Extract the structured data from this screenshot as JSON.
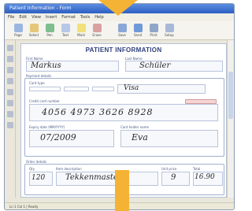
{
  "window": {
    "title": "Patient Information - Form"
  },
  "menu": [
    "File",
    "Edit",
    "View",
    "Insert",
    "Format",
    "Tools",
    "Help"
  ],
  "toolbar": [
    {
      "icon": "page-icon",
      "label": "Page",
      "color": "#9cb6e2"
    },
    {
      "icon": "select-icon",
      "label": "Select",
      "color": "#e6c77a"
    },
    {
      "icon": "pen-icon",
      "label": "Pen",
      "color": "#7fbf8f"
    },
    {
      "icon": "text-icon",
      "label": "Text",
      "color": "#b6c7e8"
    },
    {
      "icon": "highlight-icon",
      "label": "Mark",
      "color": "#f2e07a"
    },
    {
      "icon": "erase-icon",
      "label": "Erase",
      "color": "#d9a1a1"
    },
    {
      "icon": "save-icon",
      "label": "Save",
      "color": "#8aa7d6"
    },
    {
      "icon": "send-icon",
      "label": "Send",
      "color": "#6f9ad8"
    },
    {
      "icon": "print-icon",
      "label": "Print",
      "color": "#8fa6c9"
    },
    {
      "icon": "settings-icon",
      "label": "Setup",
      "color": "#a7b8d8"
    }
  ],
  "form": {
    "title": "PATIENT INFORMATION",
    "first_name_label": "First Name",
    "first_name_value": "Markus",
    "last_name_label": "Last Name",
    "last_name_value": "Schüler",
    "payment_label": "Payment details",
    "card_type_label": "Card type",
    "card_type_value": "Visa",
    "card_number_label": "Credit card number",
    "card_number_value": "4056 4973 3626 8928",
    "expiry_label": "Expiry date (MM/YYYY)",
    "expiry_value": "07/2009",
    "cardholder_label": "Card holder name",
    "cardholder_value": "Eva",
    "order_label": "Order details",
    "qty_label": "Qty",
    "qty_value": "120",
    "item_label": "Item description",
    "item_value": "Tekkenmaster",
    "unit_label": "Unit price",
    "unit_value": "9",
    "total_label": "Total",
    "total_value": "16.90"
  },
  "status": {
    "text": "Ln 1 Col 1 | Ready"
  },
  "accent": {
    "highlight": "#f5b335",
    "primary": "#2f3f7a"
  }
}
